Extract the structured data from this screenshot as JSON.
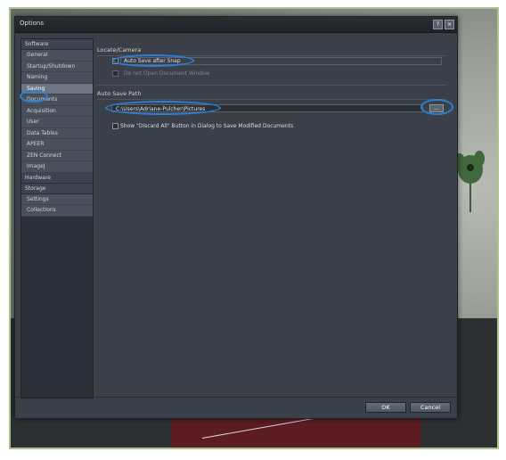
{
  "window": {
    "title": "Options",
    "help_label": "?",
    "close_label": "×"
  },
  "sidebar": {
    "groups": [
      {
        "label": "Software",
        "items": [
          {
            "label": "General"
          },
          {
            "label": "Startup/Shutdown"
          },
          {
            "label": "Naming"
          },
          {
            "label": "Saving",
            "selected": true
          },
          {
            "label": "Documents"
          },
          {
            "label": "Acquisition"
          },
          {
            "label": "User"
          },
          {
            "label": "Data Tables"
          },
          {
            "label": "APEER"
          },
          {
            "label": "ZEN Connect"
          },
          {
            "label": "ImageJ"
          }
        ]
      },
      {
        "label": "Hardware",
        "items": []
      },
      {
        "label": "Storage",
        "items": [
          {
            "label": "Settings"
          },
          {
            "label": "Collections"
          }
        ]
      }
    ]
  },
  "content": {
    "locate_camera": {
      "title": "Locate/Camera",
      "auto_save_label": "Auto Save after Snap",
      "do_not_open_label": "Do not Open Document Window"
    },
    "auto_save_path": {
      "title": "Auto Save Path",
      "path_value": "C:\\Users\\Adriane-Pulcher\\Pictures",
      "browse_label": "..."
    },
    "discard_label": "Show \"Discard All\" Button in Dialog to Save Modified Documents"
  },
  "footer": {
    "ok_label": "OK",
    "cancel_label": "Cancel"
  },
  "colors": {
    "highlight": "#2a7fd2",
    "dialog_bg": "#3b3f48",
    "sidebar_item": "#4a505b",
    "frame_border": "#a8c48c"
  }
}
